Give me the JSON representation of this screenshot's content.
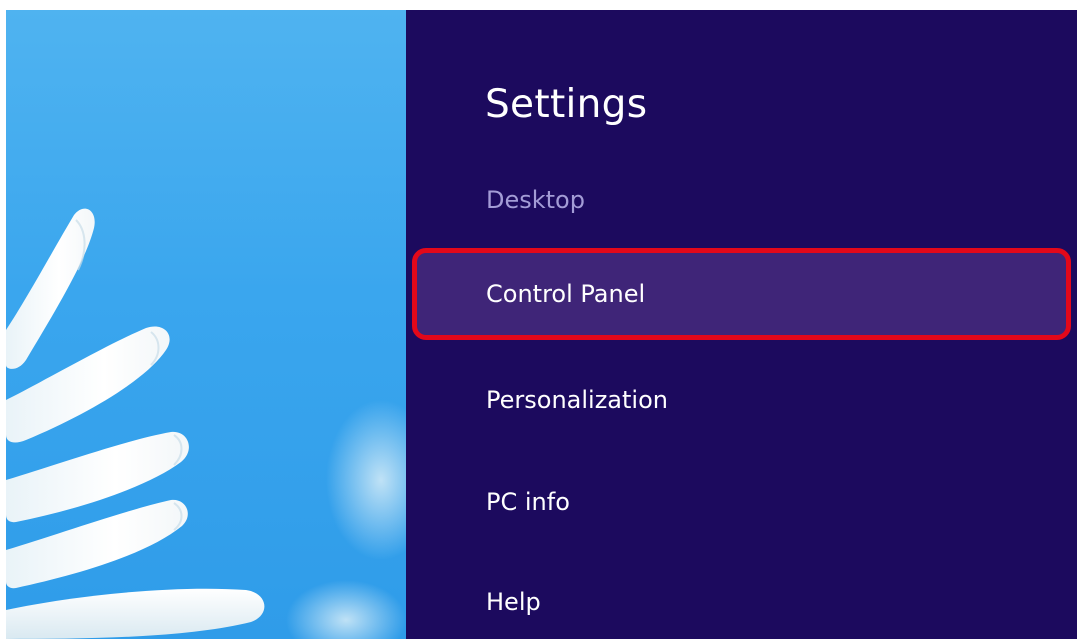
{
  "charm": {
    "title": "Settings",
    "context": "Desktop",
    "items": [
      {
        "label": "Control Panel",
        "highlighted": true
      },
      {
        "label": "Personalization"
      },
      {
        "label": "PC info"
      },
      {
        "label": "Help"
      }
    ],
    "background_color": "#1c0a5e",
    "highlight_fill_color": "#3f2578",
    "highlight_outline_color": "#e3081a",
    "context_text_color": "#a39cd6"
  },
  "wallpaper": {
    "sky_color": "#3aa6ee",
    "petal_color": "#ffffff"
  }
}
